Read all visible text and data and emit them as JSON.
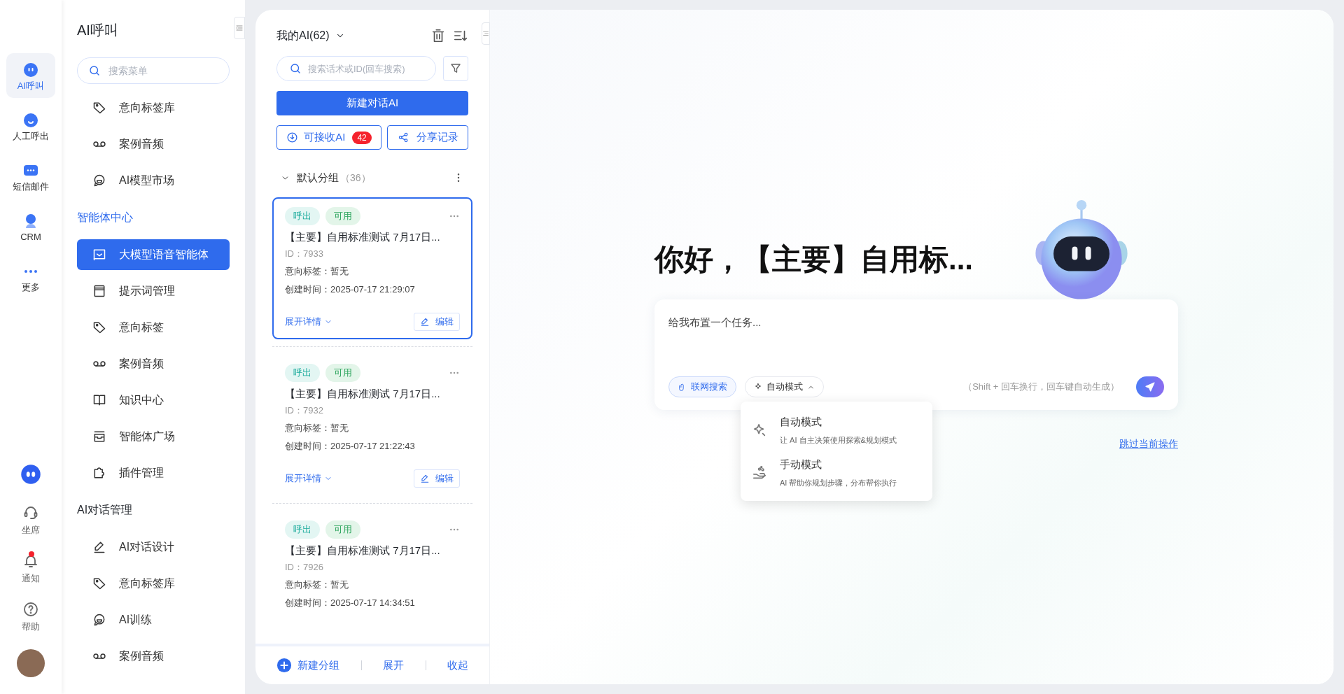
{
  "rail": {
    "items": [
      {
        "label": "AI呼叫",
        "selected": true
      },
      {
        "label": "人工呼出",
        "selected": false
      },
      {
        "label": "短信邮件",
        "selected": false
      },
      {
        "label": "CRM",
        "selected": false
      },
      {
        "label": "更多",
        "selected": false
      }
    ],
    "bottom": [
      {
        "label": "坐席",
        "dot": false
      },
      {
        "label": "通知",
        "dot": true
      },
      {
        "label": "帮助",
        "dot": false
      }
    ]
  },
  "sidebar": {
    "title": "AI呼叫",
    "search_placeholder": "搜索菜单",
    "sections": [
      {
        "items": [
          {
            "label": "意向标签库",
            "selected": false
          },
          {
            "label": "案例音频",
            "selected": false
          },
          {
            "label": "AI模型市场",
            "selected": false
          }
        ]
      },
      {
        "header": "智能体中心",
        "active": true,
        "items": [
          {
            "label": "大模型语音智能体",
            "selected": true
          },
          {
            "label": "提示词管理",
            "selected": false
          },
          {
            "label": "意向标签",
            "selected": false
          },
          {
            "label": "案例音频",
            "selected": false
          },
          {
            "label": "知识中心",
            "selected": false
          },
          {
            "label": "智能体广场",
            "selected": false
          },
          {
            "label": "插件管理",
            "selected": false
          }
        ]
      },
      {
        "header": "AI对话管理",
        "active": false,
        "items": [
          {
            "label": "AI对话设计",
            "selected": false
          },
          {
            "label": "意向标签库",
            "selected": false
          },
          {
            "label": "AI训练",
            "selected": false
          },
          {
            "label": "案例音频",
            "selected": false
          }
        ]
      }
    ]
  },
  "list": {
    "title": "我的AI(62)",
    "search_placeholder": "搜索话术或ID(回车搜索)",
    "new_button": "新建对话AI",
    "receive_button": "可接收AI",
    "receive_badge": "42",
    "share_button": "分享记录",
    "group": {
      "name": "默认分组",
      "count": "（36）",
      "expanded": true
    },
    "cards": [
      {
        "selected": true,
        "tags": [
          "呼出",
          "可用"
        ],
        "title": "【主要】自用标准测试 7月17日...",
        "id": "ID：7933",
        "intent": "意向标签：暂无",
        "created": "创建时间：2025-07-17 21:29:07",
        "expand": "展开详情",
        "edit": "编辑"
      },
      {
        "selected": false,
        "tags": [
          "呼出",
          "可用"
        ],
        "title": "【主要】自用标准测试 7月17日...",
        "id": "ID：7932",
        "intent": "意向标签：暂无",
        "created": "创建时间：2025-07-17 21:22:43",
        "expand": "展开详情",
        "edit": "编辑"
      },
      {
        "selected": false,
        "tags": [
          "呼出",
          "可用"
        ],
        "title": "【主要】自用标准测试 7月17日...",
        "id": "ID：7926",
        "intent": "意向标签：暂无",
        "created": "创建时间：2025-07-17 14:34:51"
      }
    ],
    "footer": {
      "new_group": "新建分组",
      "expand": "展开",
      "collapse": "收起"
    }
  },
  "chat": {
    "greeting": "你好，【主要】自用标...",
    "placeholder": "给我布置一个任务...",
    "web_search": "联网搜索",
    "mode": "自动模式",
    "mode_menu_open": true,
    "hint": "（Shift + 回车换行，回车键自动生成）",
    "mode_options": [
      {
        "title": "自动模式",
        "desc": "让 AI 自主决策使用探索&规划模式"
      },
      {
        "title": "手动模式",
        "desc": "AI 帮助你规划步骤，分布帮你执行"
      }
    ],
    "skip_link": "跳过当前操作"
  }
}
